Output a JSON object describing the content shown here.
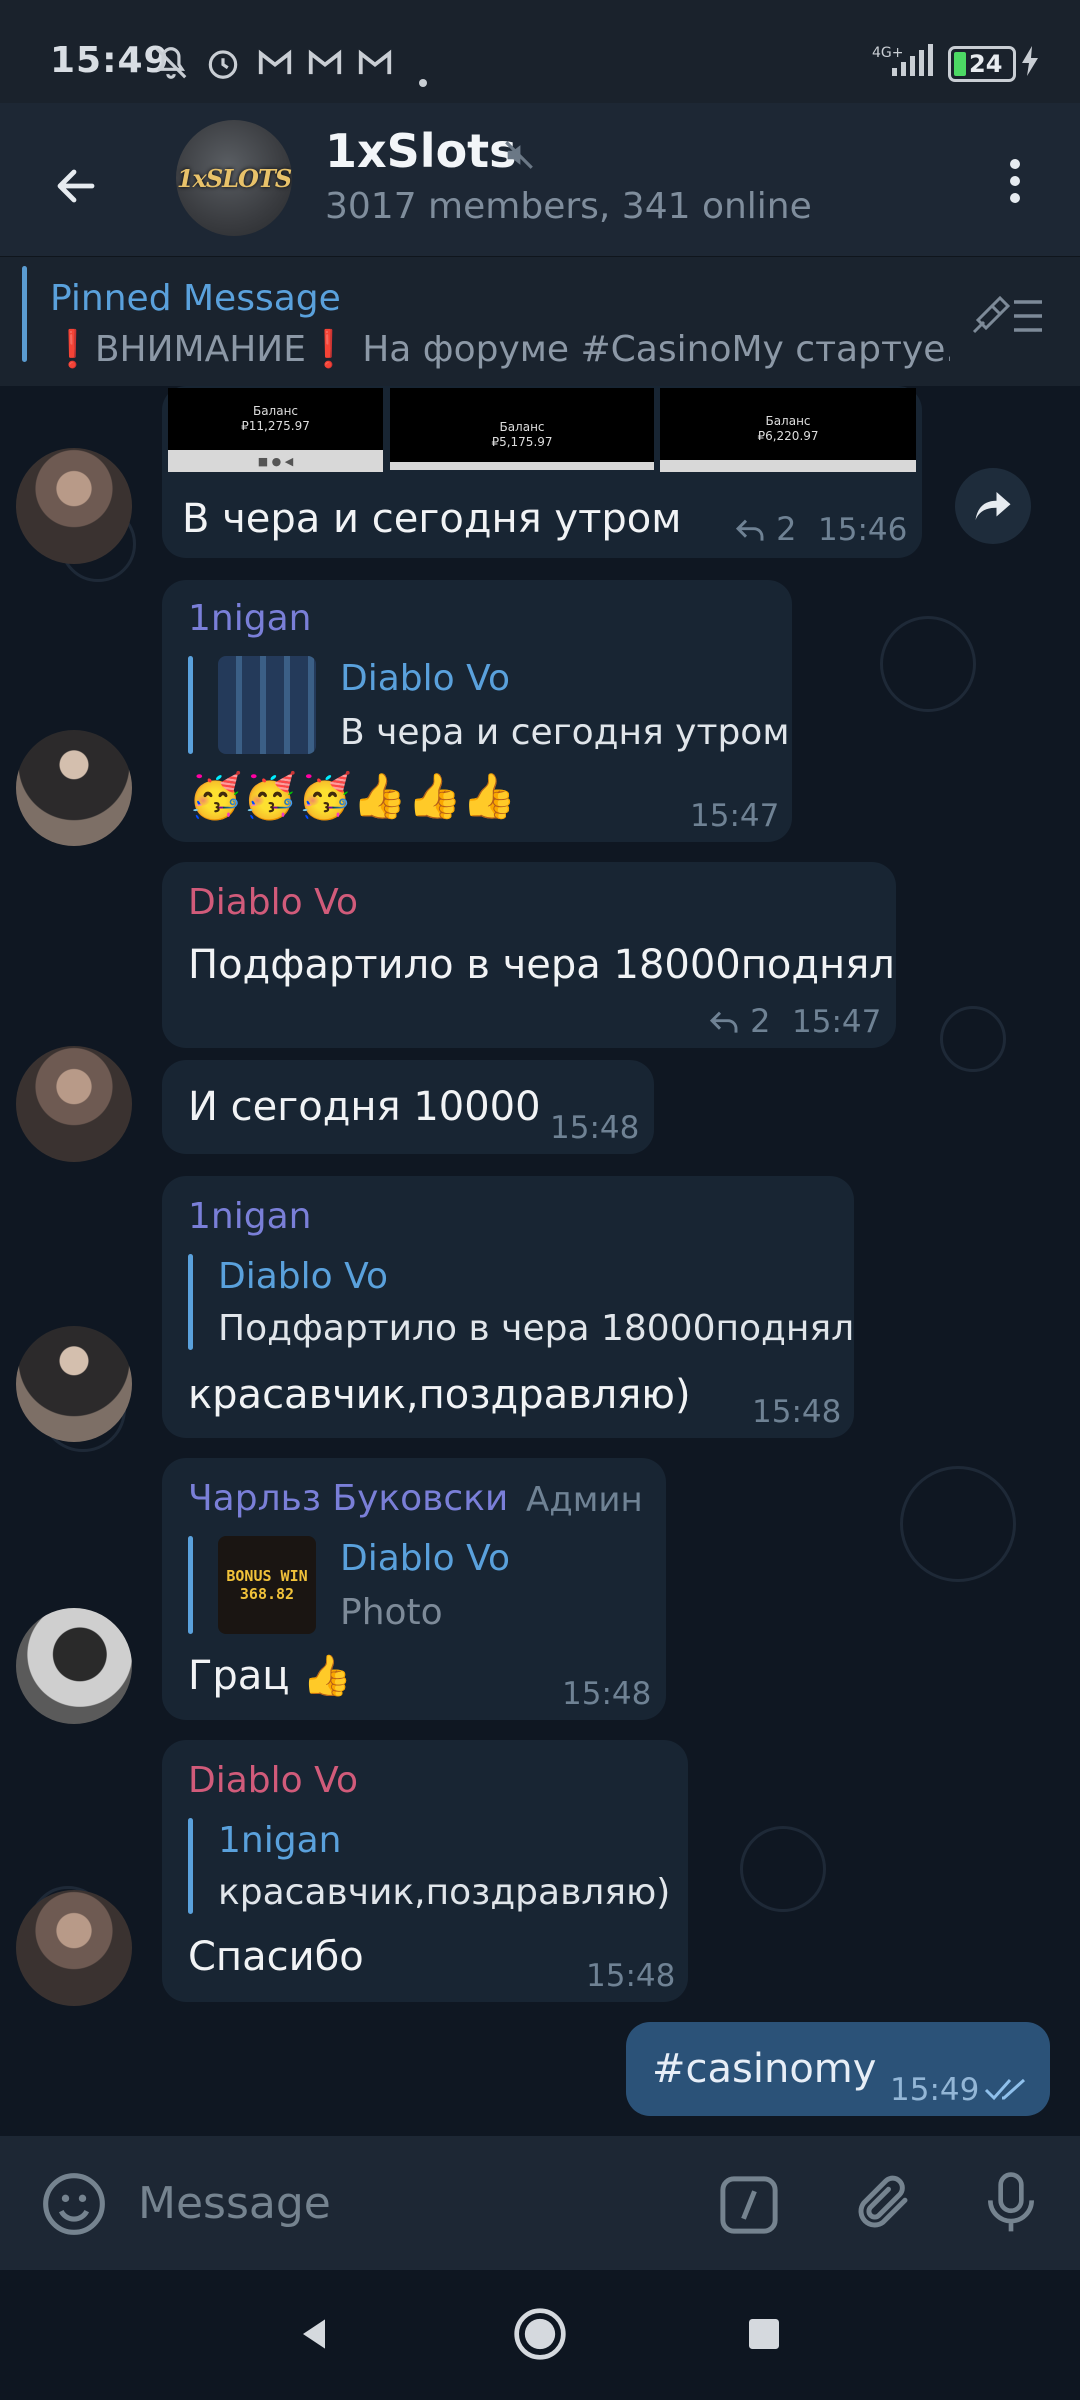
{
  "status_bar": {
    "time": "15:49",
    "network": "4G+",
    "battery": "24"
  },
  "header": {
    "avatar_logo": "1xSLOTS",
    "title": "1xSlots",
    "subtitle": "3017 members, 341 online"
  },
  "pinned": {
    "title": "Pinned Message",
    "text": "❗ВНИМАНИЕ❗ На форуме #CasinoMy стартуе..."
  },
  "top_screenshots": [
    {
      "balance_label": "Баланс",
      "balance": "₽11,275.97"
    },
    {
      "balance_label": "Баланс",
      "balance": "₽5,175.97"
    },
    {
      "balance_label": "Баланс",
      "balance": "₽6,220.97"
    }
  ],
  "messages": [
    {
      "text": "В чера и сегодня утром",
      "replies": "2",
      "time": "15:46"
    },
    {
      "sender": "1nigan",
      "reply_name": "Diablo Vo",
      "reply_text": "В чера и сегодня утром",
      "text": "🥳🥳🥳👍👍👍",
      "time": "15:47"
    },
    {
      "sender": "Diablo Vo",
      "text": "Подфартило в чера 18000поднял",
      "replies": "2",
      "time": "15:47"
    },
    {
      "text": "И сегодня 10000",
      "time": "15:48"
    },
    {
      "sender": "1nigan",
      "reply_name": "Diablo Vo",
      "reply_text": "Подфартило в чера 18000поднял",
      "text": "красавчик,поздравляю)",
      "time": "15:48"
    },
    {
      "sender": "Чарльз Буковски",
      "badge": "Админ",
      "reply_name": "Diablo Vo",
      "reply_text": "Photo",
      "reply_thumb_text": "BONUS WIN",
      "reply_thumb_value": "368.82",
      "text": "Грац 👍",
      "time": "15:48"
    },
    {
      "sender": "Diablo Vo",
      "reply_name": "1nigan",
      "reply_text": "красавчик,поздравляю)",
      "text": "Спасибо",
      "time": "15:48"
    },
    {
      "text": "#casinomy",
      "time": "15:49"
    }
  ],
  "input": {
    "placeholder": "Message"
  },
  "colors": {
    "accent": "#5aa1dc",
    "name_1nigan": "#7a7fd8",
    "name_diablo": "#d15b7a",
    "outgoing_bubble": "#2b5278",
    "incoming_bubble": "#182533"
  }
}
